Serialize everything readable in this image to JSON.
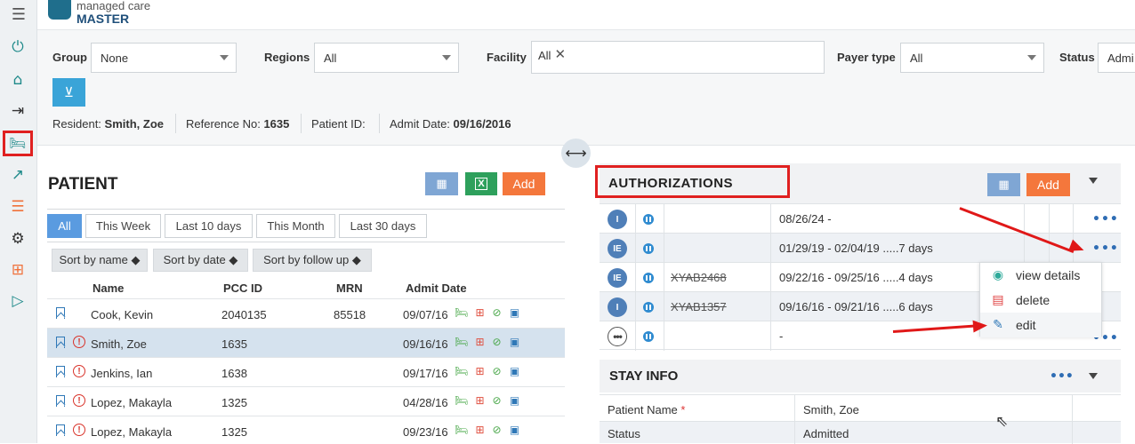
{
  "app": {
    "brand_line1": "managed care",
    "brand_line2": "MASTER"
  },
  "sidebar": {
    "items": [
      {
        "icon": "power-icon"
      },
      {
        "icon": "home-icon"
      },
      {
        "icon": "login-icon"
      },
      {
        "icon": "bed-icon"
      },
      {
        "icon": "chart-icon"
      },
      {
        "icon": "checklist-icon"
      },
      {
        "icon": "gear-icon"
      },
      {
        "icon": "medical-box-icon"
      },
      {
        "icon": "play-box-icon"
      }
    ]
  },
  "filters": {
    "group_label": "Group",
    "group_value": "None",
    "regions_label": "Regions",
    "regions_value": "All",
    "facility_label": "Facility",
    "facility_chip": "All",
    "payer_label": "Payer type",
    "payer_value": "All",
    "status_label": "Status",
    "status_value": "Admi"
  },
  "resident": {
    "resident_label": "Resident:",
    "resident_value": "Smith, Zoe",
    "ref_label": "Reference No:",
    "ref_value": "1635",
    "pid_label": "Patient ID:",
    "pid_value": "",
    "admit_label": "Admit Date:",
    "admit_value": "09/16/2016"
  },
  "patient": {
    "title": "PATIENT",
    "add_label": "Add",
    "tabs": [
      "All",
      "This Week",
      "Last 10 days",
      "This Month",
      "Last 30 days"
    ],
    "sorts": [
      "Sort by name ◆",
      "Sort by date ◆",
      "Sort by follow up ◆"
    ],
    "columns": [
      "Name",
      "PCC ID",
      "MRN",
      "Admit Date"
    ],
    "rows": [
      {
        "name": "Cook, Kevin",
        "pcc": "2040135",
        "mrn": "85518",
        "date": "09/07/16"
      },
      {
        "name": "Smith, Zoe",
        "pcc": "1635",
        "mrn": "",
        "date": "09/16/16"
      },
      {
        "name": "Jenkins, Ian",
        "pcc": "1638",
        "mrn": "",
        "date": "09/17/16"
      },
      {
        "name": "Lopez, Makayla",
        "pcc": "1325",
        "mrn": "",
        "date": "04/28/16"
      },
      {
        "name": "Lopez, Makayla",
        "pcc": "1325",
        "mrn": "",
        "date": "09/23/16"
      }
    ]
  },
  "auth": {
    "title": "AUTHORIZATIONS",
    "add_label": "Add",
    "rows": [
      {
        "type": "I",
        "code": "",
        "dates": "08/26/24 -"
      },
      {
        "type": "IE",
        "code": "",
        "dates": "01/29/19 - 02/04/19 .....7 days"
      },
      {
        "type": "IE",
        "code": "XYAB2468",
        "dates": "09/22/16 - 09/25/16 .....4 days"
      },
      {
        "type": "I",
        "code": "XYAB1357",
        "dates": "09/16/16 - 09/21/16 .....6 days"
      },
      {
        "type": "•••",
        "code": "",
        "dates": "-"
      }
    ],
    "menu": [
      "view details",
      "delete",
      "edit"
    ]
  },
  "stay": {
    "title": "STAY INFO",
    "rows": [
      {
        "label": "Patient Name",
        "required": "*",
        "value": "Smith, Zoe"
      },
      {
        "label": "Status",
        "required": "",
        "value": "Admitted"
      }
    ]
  },
  "splitter_icon": "⟷"
}
